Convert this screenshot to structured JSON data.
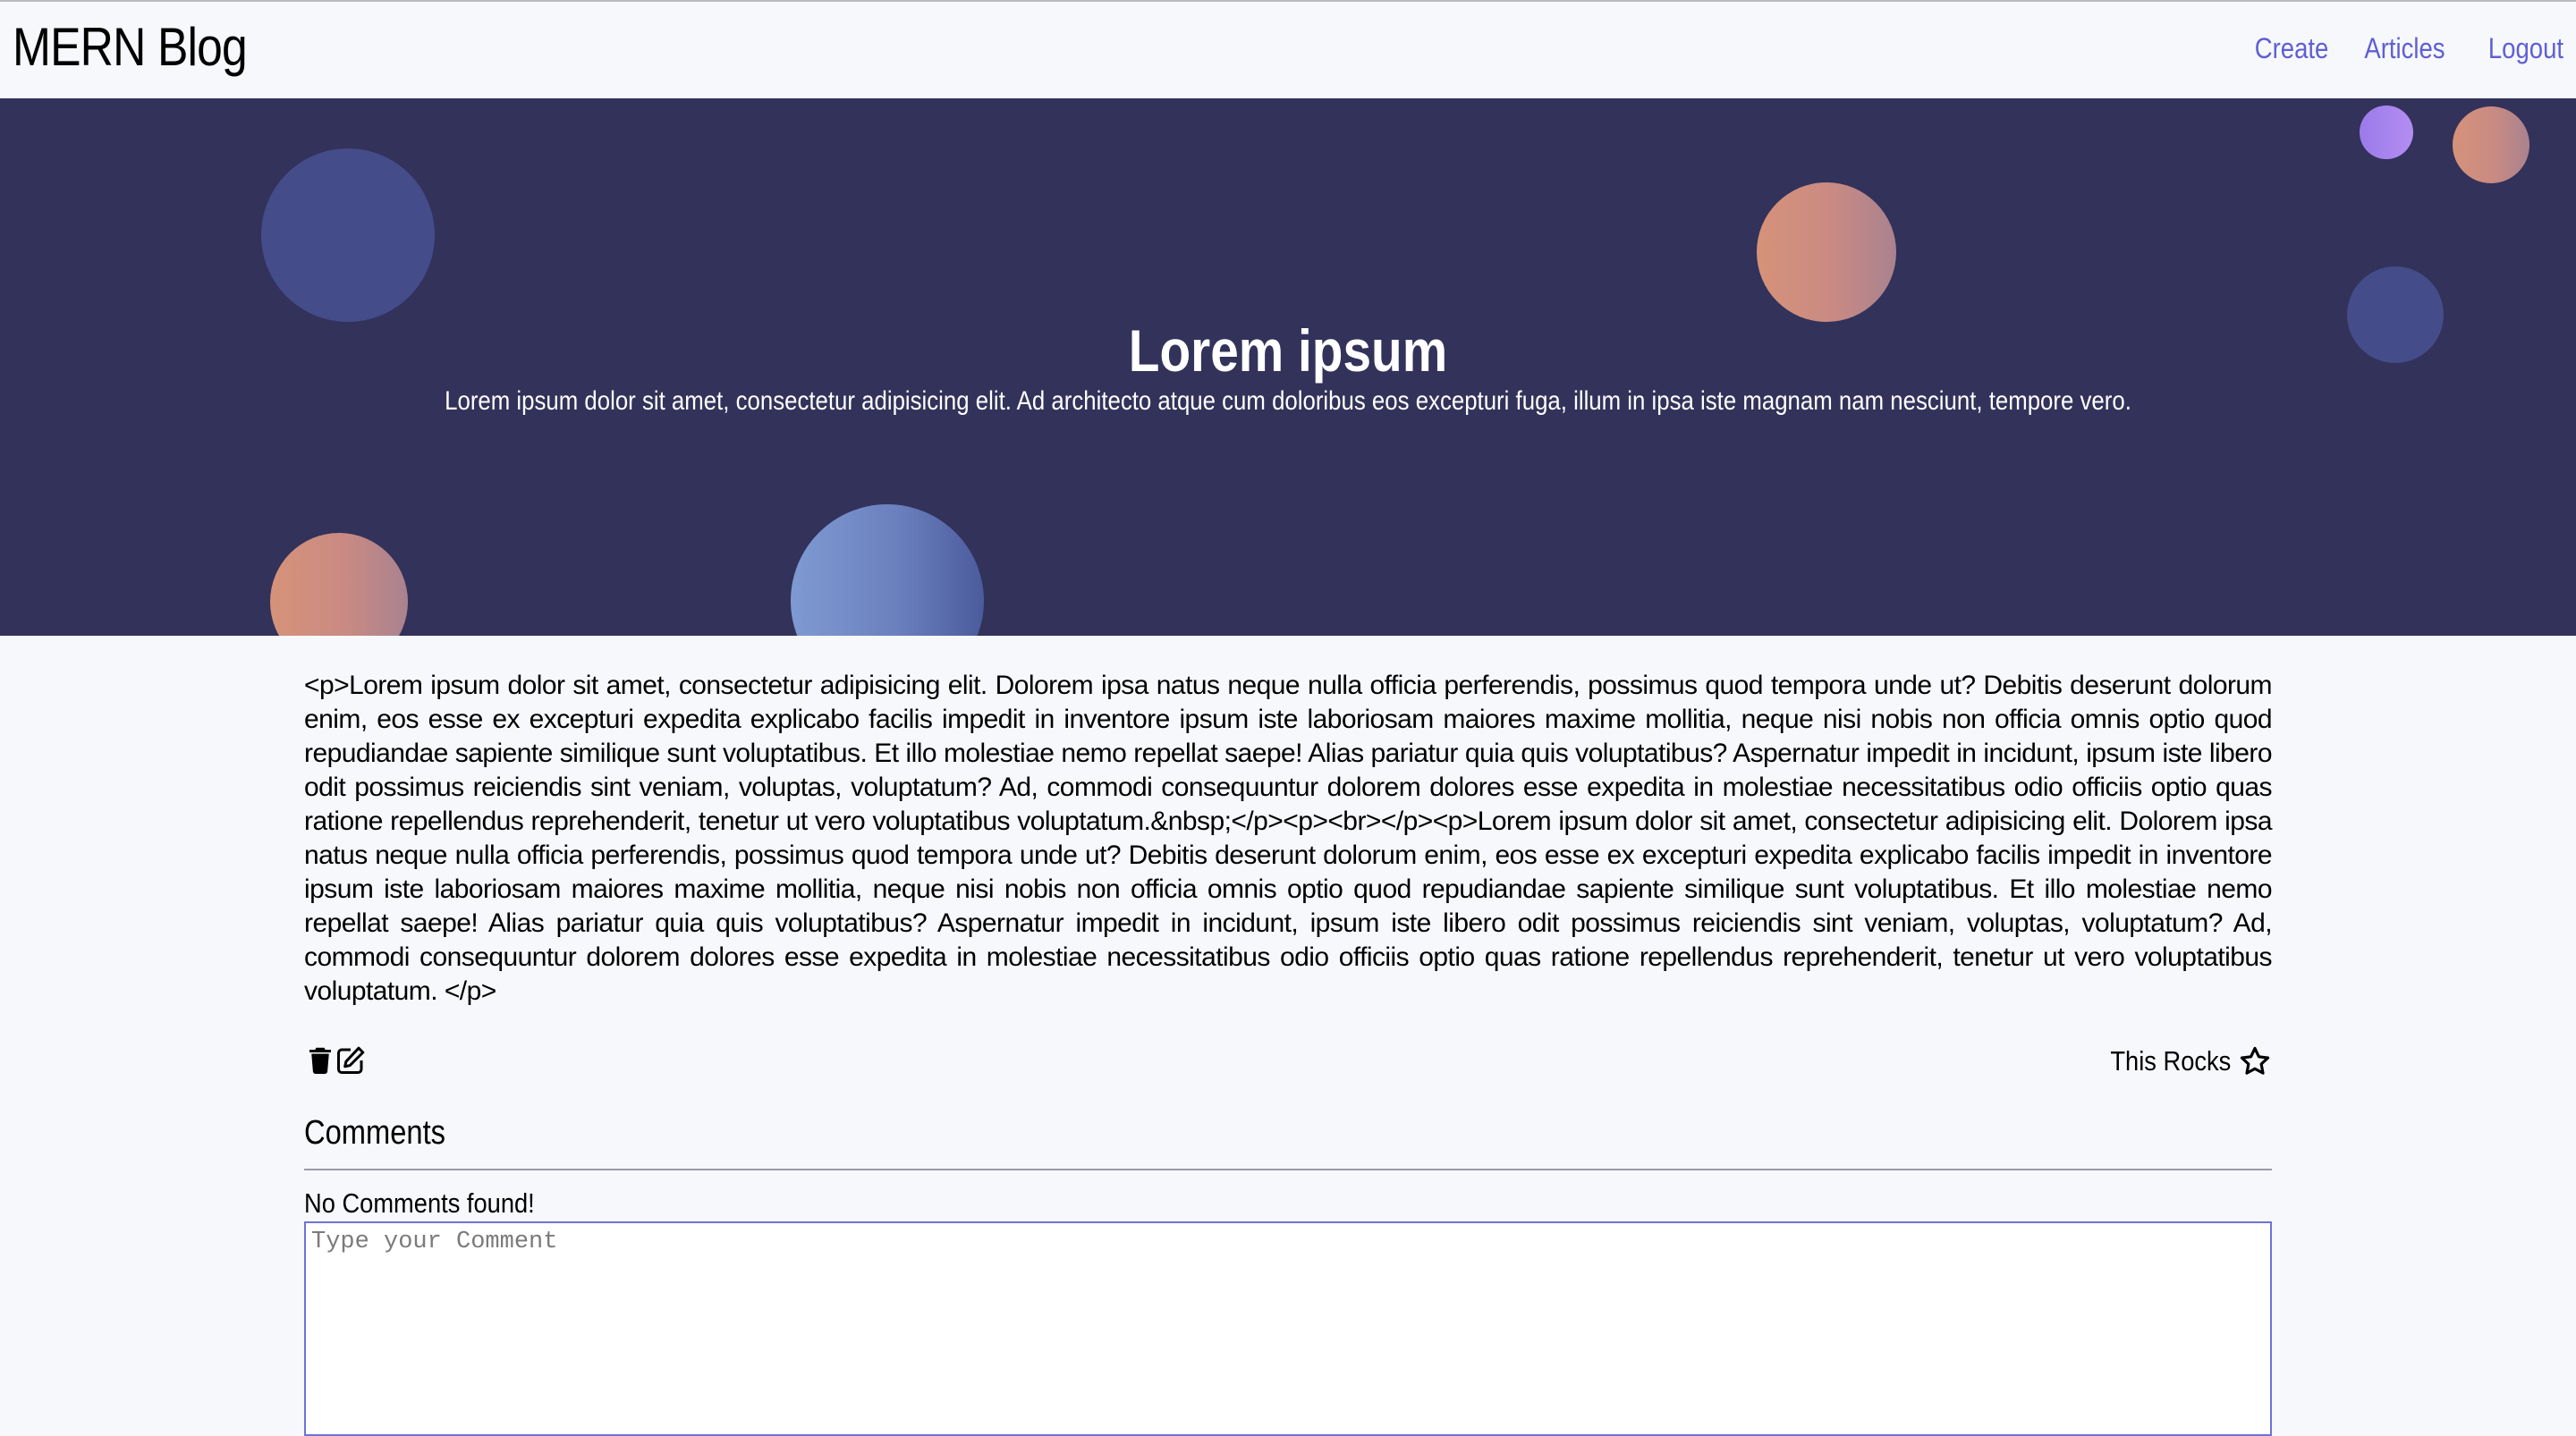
{
  "header": {
    "brand": "MERN Blog",
    "nav": {
      "create": "Create",
      "articles": "Articles",
      "logout": "Logout"
    }
  },
  "hero": {
    "title": "Lorem ipsum",
    "subtitle": "Lorem ipsum dolor sit amet, consectetur adipisicing elit. Ad architecto atque cum doloribus eos excepturi fuga, illum in ipsa iste magnam nam nesciunt, tempore vero."
  },
  "article": {
    "body": "<p>Lorem ipsum dolor sit amet, consectetur adipisicing elit. Dolorem ipsa natus neque nulla officia perferendis, possimus quod tempora unde ut? Debitis deserunt dolorum enim, eos esse ex excepturi expedita explicabo facilis impedit in inventore ipsum iste laboriosam maiores maxime mollitia, neque nisi nobis non officia omnis optio quod repudiandae sapiente similique sunt voluptatibus. Et illo molestiae nemo repellat saepe! Alias pariatur quia quis voluptatibus? Aspernatur impedit in incidunt, ipsum iste libero odit possimus reiciendis sint veniam, voluptas, voluptatum? Ad, commodi consequuntur dolorem dolores esse expedita in molestiae necessitatibus odio officiis optio quas ratione repellendus reprehenderit, tenetur ut vero voluptatibus voluptatum.&nbsp;</p><p><br></p><p>Lorem ipsum dolor sit amet, consectetur adipisicing elit. Dolorem ipsa natus neque nulla officia perferendis, possimus quod tempora unde ut? Debitis deserunt dolorum enim, eos esse ex excepturi expedita explicabo facilis impedit in inventore ipsum iste laboriosam maiores maxime mollitia, neque nisi nobis non officia omnis optio quod repudiandae sapiente similique sunt voluptatibus. Et illo molestiae nemo repellat saepe! Alias pariatur quia quis voluptatibus? Aspernatur impedit in incidunt, ipsum iste libero odit possimus reiciendis sint veniam, voluptas, voluptatum? Ad, commodi consequuntur dolorem dolores esse expedita in molestiae necessitatibus odio officiis optio quas ratione repellendus reprehenderit, tenetur ut vero voluptatibus voluptatum. </p>",
    "actions": {
      "delete_icon": "trash-icon",
      "edit_icon": "edit-icon",
      "rock_label": "This Rocks",
      "rock_icon": "star-icon"
    }
  },
  "comments": {
    "title": "Comments",
    "empty_message": "No Comments found!",
    "input_placeholder": "Type your Comment",
    "input_value": ""
  },
  "colors": {
    "nav_link": "#5f5fd3",
    "hero_background": "#32325a",
    "page_background": "#f7f8fc",
    "input_border": "#6f73d6"
  }
}
